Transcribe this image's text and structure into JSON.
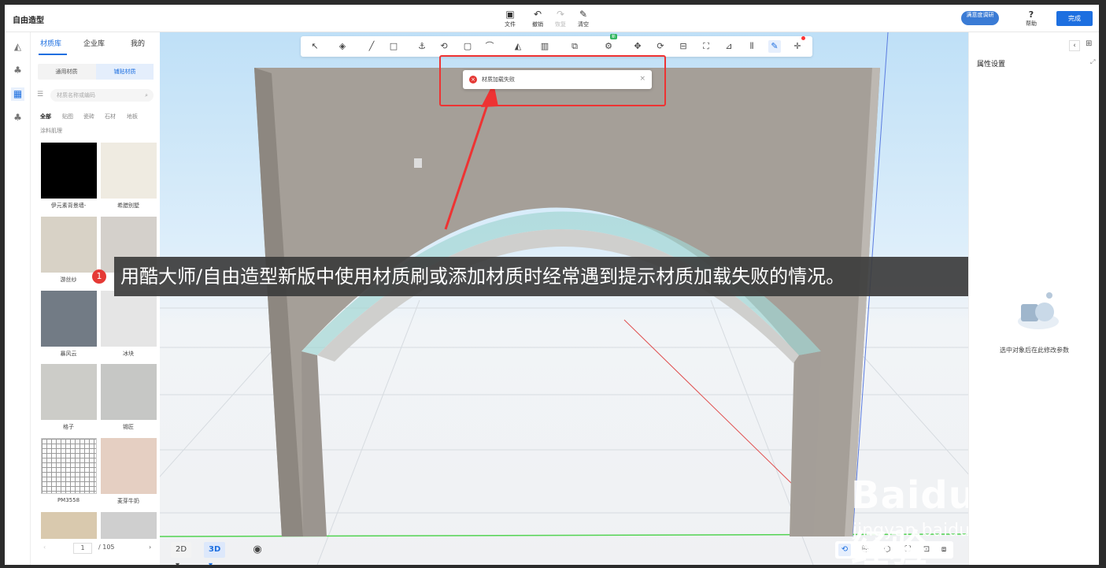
{
  "app": {
    "title": "自由造型"
  },
  "header": {
    "file": "文件",
    "undo": "撤销",
    "redo": "恢复",
    "clear": "清空",
    "satisfaction_badge": "满意度调研",
    "help": "帮助",
    "done": "完成"
  },
  "material_panel": {
    "tabs": [
      "材质库",
      "企业库",
      "我的"
    ],
    "active_tab": "材质库",
    "segments": [
      "通用材质",
      "铺贴材质"
    ],
    "active_segment": "铺贴材质",
    "search_placeholder": "材质名称或编码",
    "categories": [
      "全部",
      "贴图",
      "瓷砖",
      "石材",
      "地板",
      "涂料肌理"
    ],
    "active_category": "全部",
    "items": [
      {
        "name": "伊元素背景墙-",
        "color": "#000000"
      },
      {
        "name": "希腊别墅",
        "color": "#efebe1"
      },
      {
        "name": "游丝纱",
        "color": "#d8d2c6"
      },
      {
        "name": "",
        "color": "#d4d0cb"
      },
      {
        "name": "暴风云",
        "color": "#727b85"
      },
      {
        "name": "冰块",
        "color": "#e5e5e5"
      },
      {
        "name": "格子",
        "color": "#ccccc8"
      },
      {
        "name": "锡匠",
        "color": "#c6c7c5"
      },
      {
        "name": "PM3558",
        "color": "#ffffff"
      },
      {
        "name": "麦芽牛奶",
        "color": "#e5cfc2"
      }
    ],
    "pager": {
      "current": "1",
      "total": "/ 105"
    }
  },
  "toast": {
    "message": "材质加载失败"
  },
  "caption": {
    "number": "1",
    "text": "用酷大师/自由造型新版中使用材质刷或添加材质时经常遇到提示材质加载失败的情况。"
  },
  "viewport": {
    "mode_2d": "2D",
    "mode_3d": "3D",
    "active_mode": "3D",
    "toolbar_new_badge": "新"
  },
  "watermark": {
    "brand": "Baidu经验",
    "url": "jingyan.baidu.com"
  },
  "right_panel": {
    "title": "属性设置",
    "empty_hint": "选中对象后在此修改参数"
  }
}
